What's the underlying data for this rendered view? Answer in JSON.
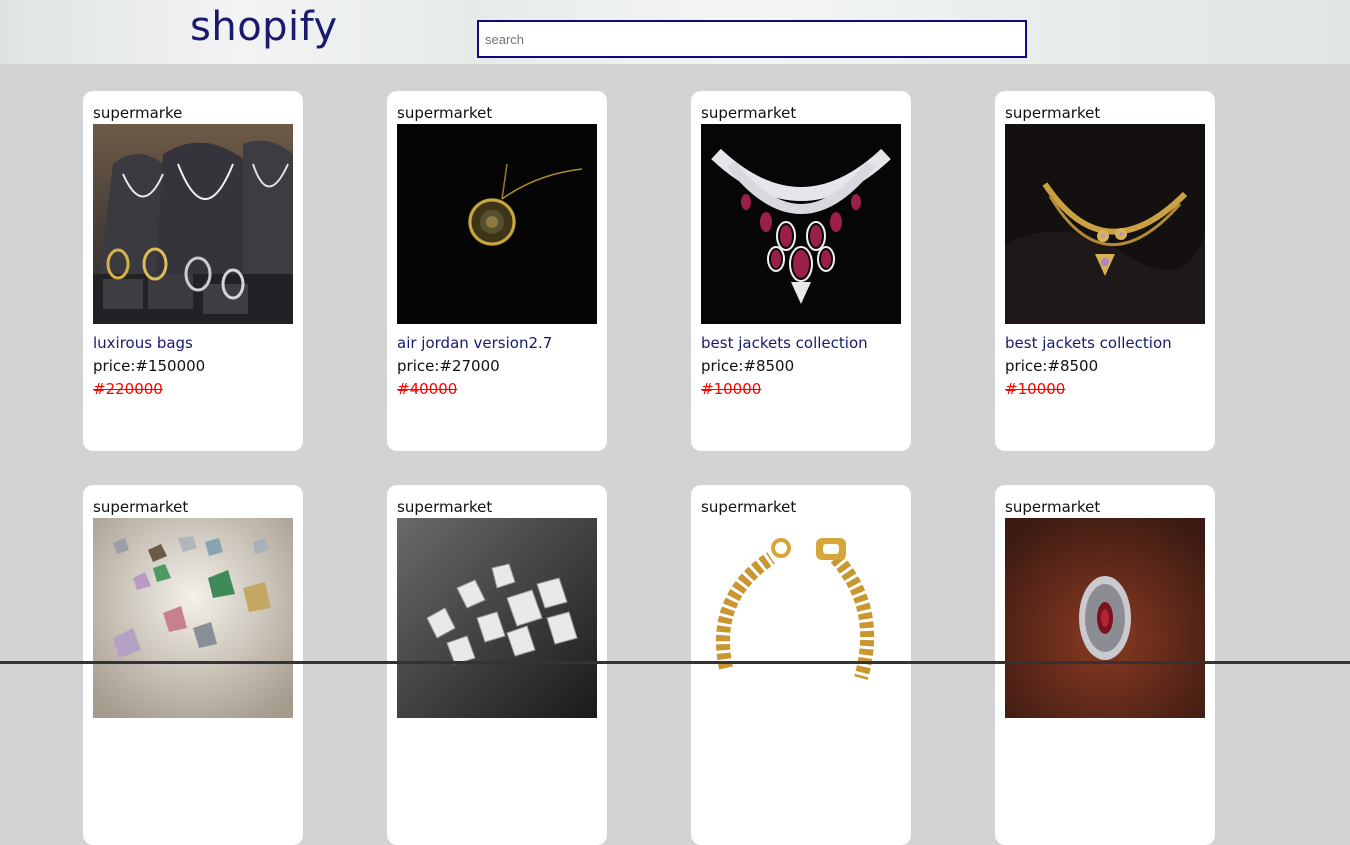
{
  "header": {
    "logo": "shopify",
    "search_placeholder": "search"
  },
  "products": [
    {
      "store": "supermarke",
      "image": "jewelry-display-image",
      "name": "luxirous bags",
      "price": "price:#150000",
      "old_price": "#220000"
    },
    {
      "store": "supermarket",
      "image": "pendant-necklace-image",
      "name": "air jordan version2.7",
      "price": "price:#27000",
      "old_price": "#40000"
    },
    {
      "store": "supermarket",
      "image": "ruby-necklace-image",
      "name": "best jackets collection",
      "price": "price:#8500",
      "old_price": "#10000"
    },
    {
      "store": "supermarket",
      "image": "gold-necklace-set-image",
      "name": "best jackets collection",
      "price": "price:#8500",
      "old_price": "#10000"
    },
    {
      "store": "supermarket",
      "image": "gemstones-image",
      "name": "",
      "price": "",
      "old_price": ""
    },
    {
      "store": "supermarket",
      "image": "diamonds-image",
      "name": "",
      "price": "",
      "old_price": ""
    },
    {
      "store": "supermarket",
      "image": "gold-bracelet-image",
      "name": "",
      "price": "",
      "old_price": ""
    },
    {
      "store": "supermarket",
      "image": "ruby-ring-image",
      "name": "",
      "price": "",
      "old_price": ""
    }
  ]
}
